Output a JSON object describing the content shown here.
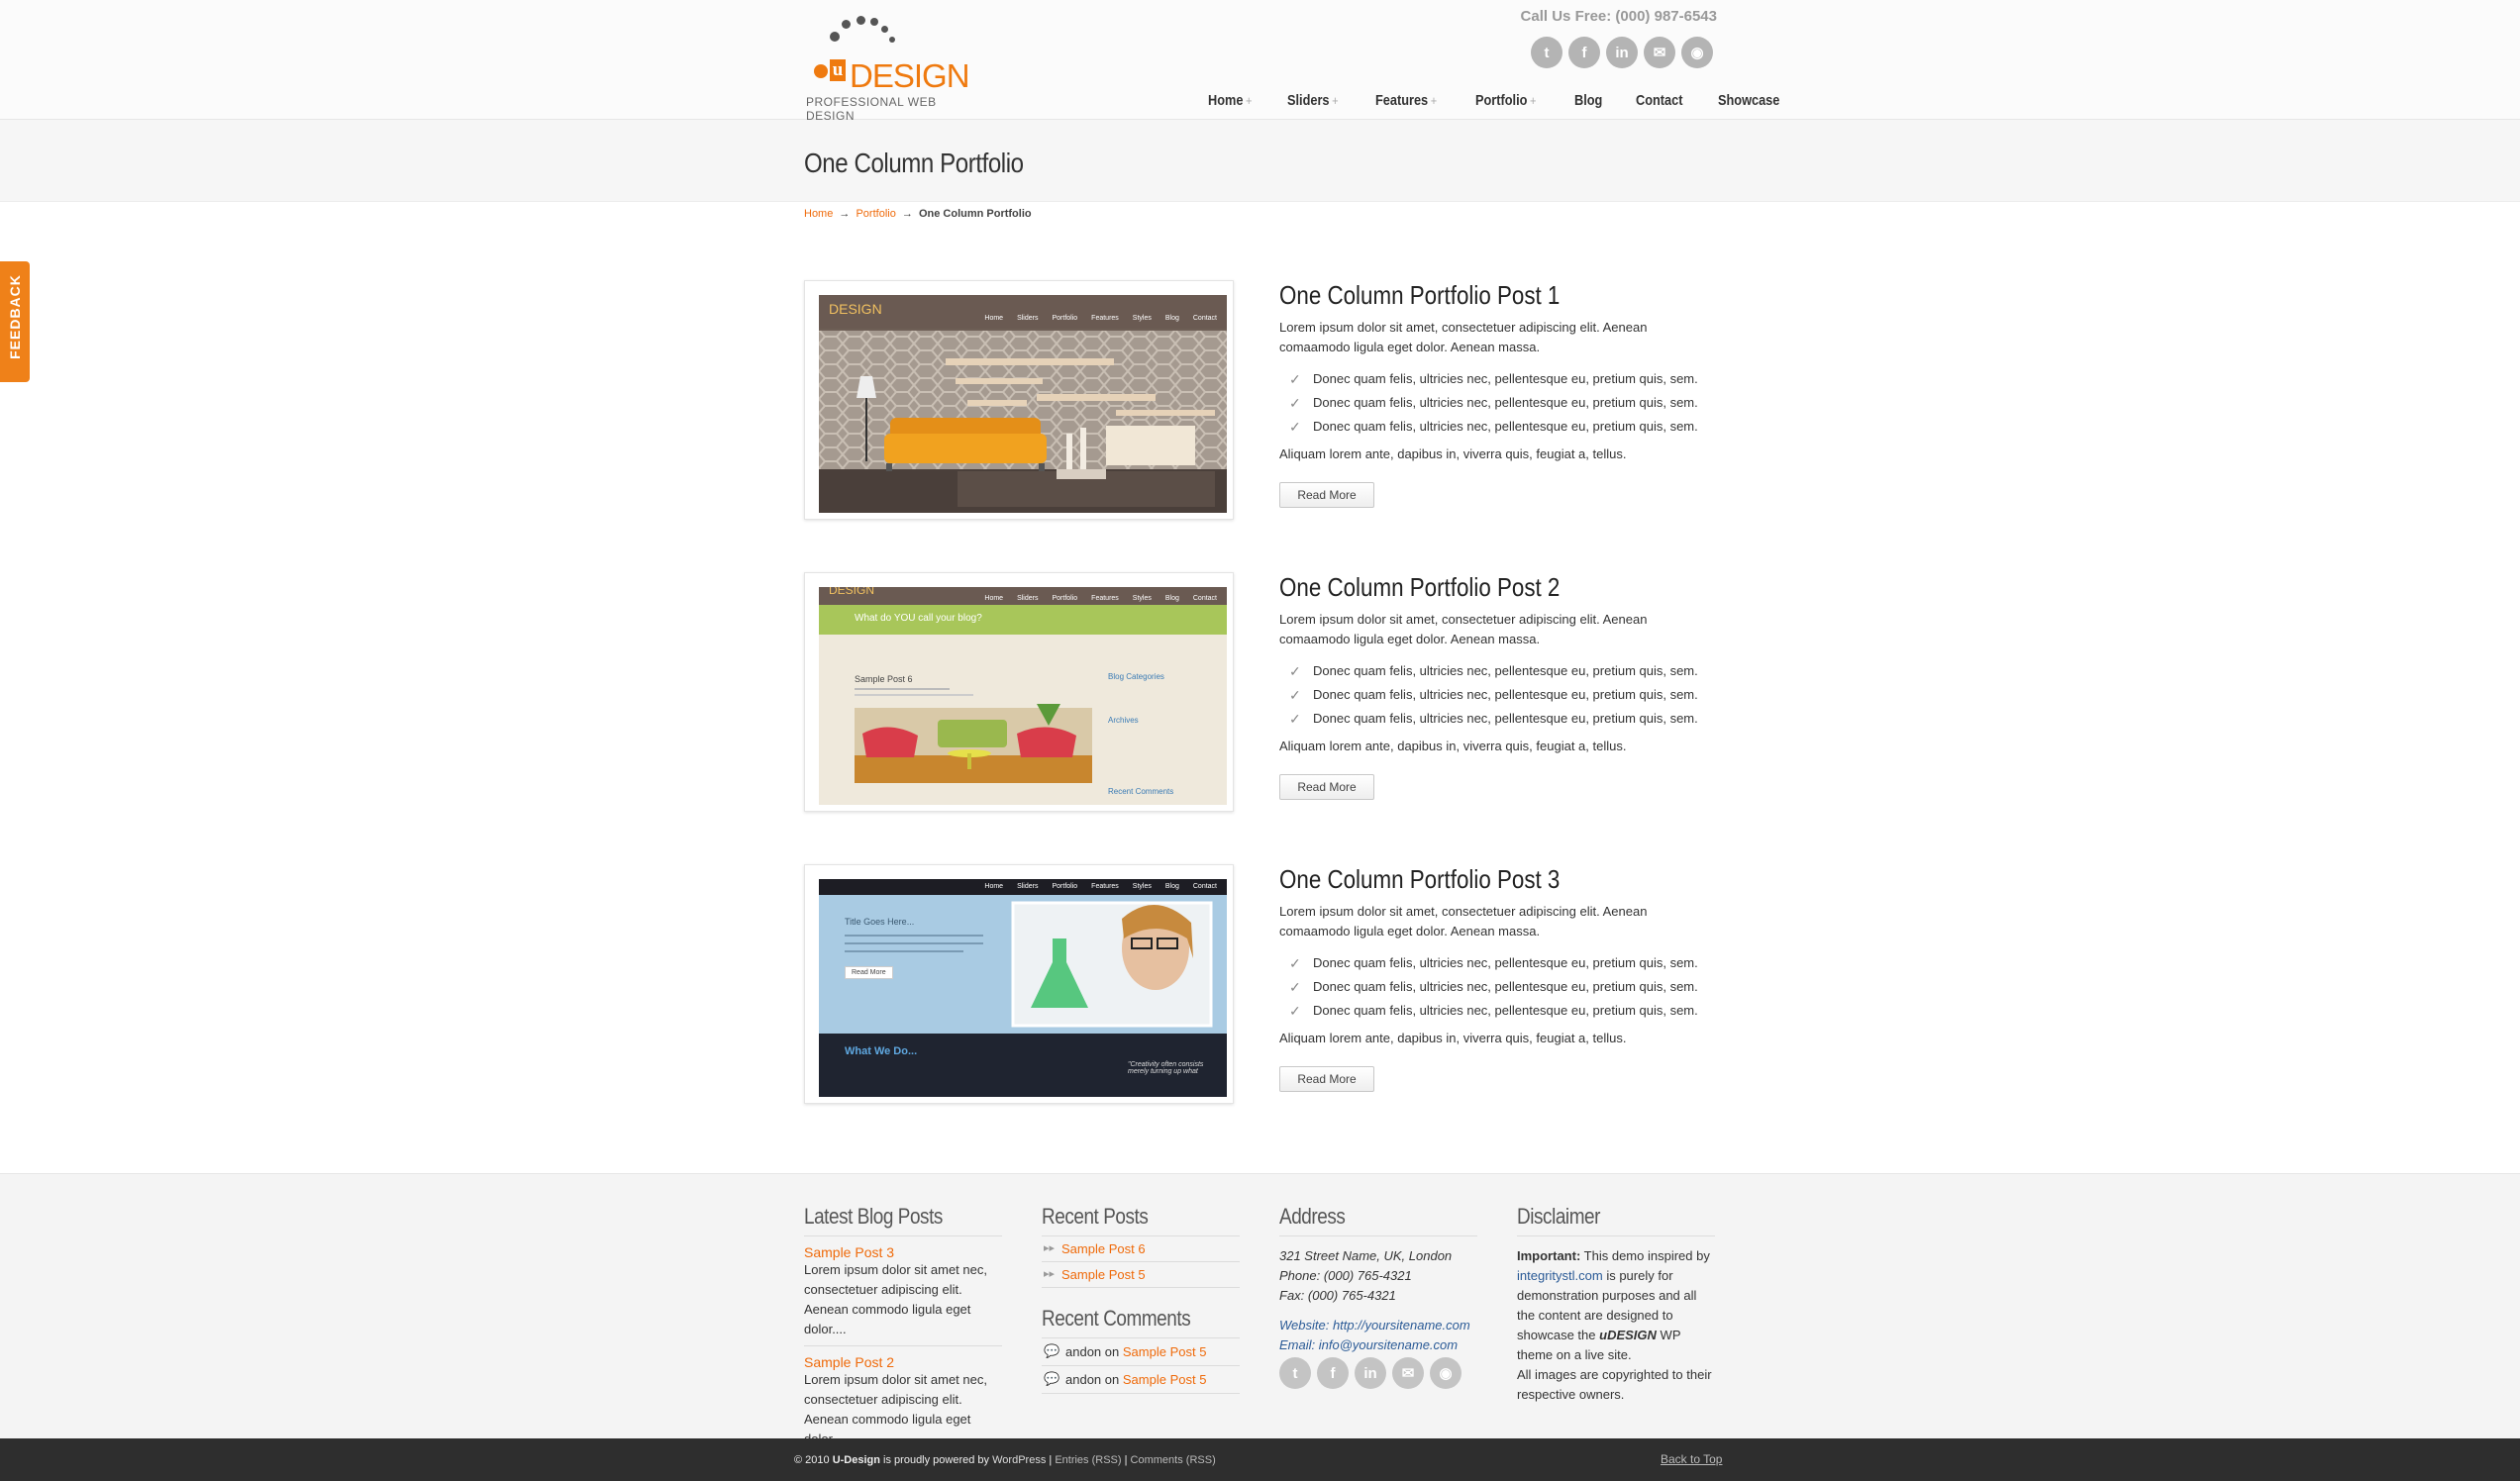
{
  "header": {
    "logo_mark": "u",
    "logo_text": "DESIGN",
    "logo_tagline": "PROFESSIONAL WEB DESIGN",
    "call_us": "Call Us Free: (000) 987-6543",
    "social_icons": [
      "twitter-icon",
      "facebook-icon",
      "linkedin-icon",
      "email-icon",
      "rss-icon"
    ],
    "nav": [
      {
        "label": "Home",
        "has_sub": "+"
      },
      {
        "label": "Sliders",
        "has_sub": "+"
      },
      {
        "label": "Features",
        "has_sub": "+"
      },
      {
        "label": "Portfolio",
        "has_sub": "+"
      },
      {
        "label": "Blog",
        "has_sub": ""
      },
      {
        "label": "Contact",
        "has_sub": ""
      },
      {
        "label": "Showcase",
        "has_sub": ""
      }
    ]
  },
  "page": {
    "title": "One Column Portfolio",
    "breadcrumb": {
      "home": "Home",
      "arrow": "→",
      "portfolio": "Portfolio",
      "current": "One Column Portfolio"
    }
  },
  "feedback_tab": "FEEDBACK",
  "posts": [
    {
      "title": "One Column Portfolio Post 1",
      "desc": "Lorem ipsum dolor sit amet, consectetuer adipiscing elit. Aenean comaamodo ligula eget dolor. Aenean massa.",
      "items": [
        "Donec quam felis, ultricies nec, pellentesque eu, pretium quis, sem.",
        "Donec quam felis, ultricies nec, pellentesque eu, pretium quis, sem.",
        "Donec quam felis, ultricies nec, pellentesque eu, pretium quis, sem."
      ],
      "extra": "Aliquam lorem ante, dapibus in, viverra quis, feugiat a, tellus.",
      "button": "Read More"
    },
    {
      "title": "One Column Portfolio Post 2",
      "desc": "Lorem ipsum dolor sit amet, consectetuer adipiscing elit. Aenean comaamodo ligula eget dolor. Aenean massa.",
      "items": [
        "Donec quam felis, ultricies nec, pellentesque eu, pretium quis, sem.",
        "Donec quam felis, ultricies nec, pellentesque eu, pretium quis, sem.",
        "Donec quam felis, ultricies nec, pellentesque eu, pretium quis, sem."
      ],
      "extra": "Aliquam lorem ante, dapibus in, viverra quis, feugiat a, tellus.",
      "button": "Read More"
    },
    {
      "title": "One Column Portfolio Post 3",
      "desc": "Lorem ipsum dolor sit amet, consectetuer adipiscing elit. Aenean comaamodo ligula eget dolor. Aenean massa.",
      "items": [
        "Donec quam felis, ultricies nec, pellentesque eu, pretium quis, sem.",
        "Donec quam felis, ultricies nec, pellentesque eu, pretium quis, sem.",
        "Donec quam felis, ultricies nec, pellentesque eu, pretium quis, sem."
      ],
      "extra": "Aliquam lorem ante, dapibus in, viverra quis, feugiat a, tellus.",
      "button": "Read More"
    }
  ],
  "thumbs": {
    "t1": {
      "logo": "DESIGN",
      "links": [
        "Home",
        "Sliders",
        "Portfolio",
        "Features",
        "Styles",
        "Blog",
        "Contact"
      ]
    },
    "t2": {
      "logo": "DESIGN",
      "links": [
        "Home",
        "Sliders",
        "Portfolio",
        "Features",
        "Styles",
        "Blog",
        "Contact"
      ],
      "banner": "What do YOU call your blog?",
      "post_title": "Sample Post 6",
      "side_h1": "Blog Categories",
      "side_h2": "Archives",
      "side_h3": "Recent Comments"
    },
    "t3": {
      "links": [
        "Home",
        "Sliders",
        "Portfolio",
        "Features",
        "Styles",
        "Blog",
        "Contact"
      ],
      "hero_title": "Title Goes Here...",
      "hero_btn": "Read More",
      "what": "What We Do...",
      "quote": "\"Creativity often consists merely turning up what"
    }
  },
  "footer": {
    "latest": {
      "heading": "Latest Blog Posts",
      "posts": [
        {
          "title": "Sample Post 3",
          "text": "Lorem ipsum dolor sit amet nec, consectetuer adipiscing elit. Aenean commodo ligula eget dolor...."
        },
        {
          "title": "Sample Post 2",
          "text": "Lorem ipsum dolor sit amet nec, consectetuer adipiscing elit. Aenean commodo ligula eget dolor...."
        }
      ]
    },
    "recent_posts": {
      "heading": "Recent Posts",
      "items": [
        "Sample Post 6",
        "Sample Post 5"
      ]
    },
    "recent_comments": {
      "heading": "Recent Comments",
      "items": [
        {
          "author": "andon",
          "on": "on",
          "post": "Sample Post 5"
        },
        {
          "author": "andon",
          "on": "on",
          "post": "Sample Post 5"
        }
      ]
    },
    "address": {
      "heading": "Address",
      "line1": "321 Street Name, UK, London",
      "line2": "Phone: (000) 765-4321",
      "line3": "Fax: (000) 765-4321",
      "website": "Website: http://yoursitename.com",
      "email": "Email: info@yoursitename.com"
    },
    "disclaimer": {
      "heading": "Disclaimer",
      "important": "Important:",
      "p1": "This demo inspired by",
      "link": "integritystl.com",
      "p2": "is purely for demonstration purposes and all the content are designed to showcase the",
      "brand": "uDESIGN",
      "p3": "WP theme on a live site.",
      "p4": "All images are copyrighted to their respective owners."
    }
  },
  "bottom": {
    "copy_pre": "© 2010",
    "brand": "U-Design",
    "copy_mid": "is proudly powered by",
    "wp": "WordPress",
    "sep": "|",
    "entries": "Entries (RSS)",
    "comments": "Comments (RSS)",
    "back_top": "Back to Top"
  },
  "colors": {
    "accent": "#ef6a0a",
    "link_blue": "#2a5a96",
    "footer_bg": "#f4f4f4",
    "bottom_bar": "#2e2e2e"
  }
}
